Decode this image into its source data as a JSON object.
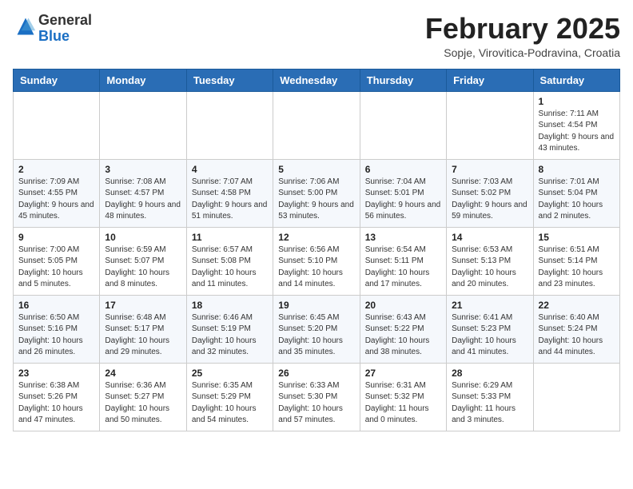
{
  "header": {
    "logo_general": "General",
    "logo_blue": "Blue",
    "month": "February 2025",
    "location": "Sopje, Virovitica-Podravina, Croatia"
  },
  "weekdays": [
    "Sunday",
    "Monday",
    "Tuesday",
    "Wednesday",
    "Thursday",
    "Friday",
    "Saturday"
  ],
  "weeks": [
    [
      {
        "day": "",
        "info": ""
      },
      {
        "day": "",
        "info": ""
      },
      {
        "day": "",
        "info": ""
      },
      {
        "day": "",
        "info": ""
      },
      {
        "day": "",
        "info": ""
      },
      {
        "day": "",
        "info": ""
      },
      {
        "day": "1",
        "info": "Sunrise: 7:11 AM\nSunset: 4:54 PM\nDaylight: 9 hours and 43 minutes."
      }
    ],
    [
      {
        "day": "2",
        "info": "Sunrise: 7:09 AM\nSunset: 4:55 PM\nDaylight: 9 hours and 45 minutes."
      },
      {
        "day": "3",
        "info": "Sunrise: 7:08 AM\nSunset: 4:57 PM\nDaylight: 9 hours and 48 minutes."
      },
      {
        "day": "4",
        "info": "Sunrise: 7:07 AM\nSunset: 4:58 PM\nDaylight: 9 hours and 51 minutes."
      },
      {
        "day": "5",
        "info": "Sunrise: 7:06 AM\nSunset: 5:00 PM\nDaylight: 9 hours and 53 minutes."
      },
      {
        "day": "6",
        "info": "Sunrise: 7:04 AM\nSunset: 5:01 PM\nDaylight: 9 hours and 56 minutes."
      },
      {
        "day": "7",
        "info": "Sunrise: 7:03 AM\nSunset: 5:02 PM\nDaylight: 9 hours and 59 minutes."
      },
      {
        "day": "8",
        "info": "Sunrise: 7:01 AM\nSunset: 5:04 PM\nDaylight: 10 hours and 2 minutes."
      }
    ],
    [
      {
        "day": "9",
        "info": "Sunrise: 7:00 AM\nSunset: 5:05 PM\nDaylight: 10 hours and 5 minutes."
      },
      {
        "day": "10",
        "info": "Sunrise: 6:59 AM\nSunset: 5:07 PM\nDaylight: 10 hours and 8 minutes."
      },
      {
        "day": "11",
        "info": "Sunrise: 6:57 AM\nSunset: 5:08 PM\nDaylight: 10 hours and 11 minutes."
      },
      {
        "day": "12",
        "info": "Sunrise: 6:56 AM\nSunset: 5:10 PM\nDaylight: 10 hours and 14 minutes."
      },
      {
        "day": "13",
        "info": "Sunrise: 6:54 AM\nSunset: 5:11 PM\nDaylight: 10 hours and 17 minutes."
      },
      {
        "day": "14",
        "info": "Sunrise: 6:53 AM\nSunset: 5:13 PM\nDaylight: 10 hours and 20 minutes."
      },
      {
        "day": "15",
        "info": "Sunrise: 6:51 AM\nSunset: 5:14 PM\nDaylight: 10 hours and 23 minutes."
      }
    ],
    [
      {
        "day": "16",
        "info": "Sunrise: 6:50 AM\nSunset: 5:16 PM\nDaylight: 10 hours and 26 minutes."
      },
      {
        "day": "17",
        "info": "Sunrise: 6:48 AM\nSunset: 5:17 PM\nDaylight: 10 hours and 29 minutes."
      },
      {
        "day": "18",
        "info": "Sunrise: 6:46 AM\nSunset: 5:19 PM\nDaylight: 10 hours and 32 minutes."
      },
      {
        "day": "19",
        "info": "Sunrise: 6:45 AM\nSunset: 5:20 PM\nDaylight: 10 hours and 35 minutes."
      },
      {
        "day": "20",
        "info": "Sunrise: 6:43 AM\nSunset: 5:22 PM\nDaylight: 10 hours and 38 minutes."
      },
      {
        "day": "21",
        "info": "Sunrise: 6:41 AM\nSunset: 5:23 PM\nDaylight: 10 hours and 41 minutes."
      },
      {
        "day": "22",
        "info": "Sunrise: 6:40 AM\nSunset: 5:24 PM\nDaylight: 10 hours and 44 minutes."
      }
    ],
    [
      {
        "day": "23",
        "info": "Sunrise: 6:38 AM\nSunset: 5:26 PM\nDaylight: 10 hours and 47 minutes."
      },
      {
        "day": "24",
        "info": "Sunrise: 6:36 AM\nSunset: 5:27 PM\nDaylight: 10 hours and 50 minutes."
      },
      {
        "day": "25",
        "info": "Sunrise: 6:35 AM\nSunset: 5:29 PM\nDaylight: 10 hours and 54 minutes."
      },
      {
        "day": "26",
        "info": "Sunrise: 6:33 AM\nSunset: 5:30 PM\nDaylight: 10 hours and 57 minutes."
      },
      {
        "day": "27",
        "info": "Sunrise: 6:31 AM\nSunset: 5:32 PM\nDaylight: 11 hours and 0 minutes."
      },
      {
        "day": "28",
        "info": "Sunrise: 6:29 AM\nSunset: 5:33 PM\nDaylight: 11 hours and 3 minutes."
      },
      {
        "day": "",
        "info": ""
      }
    ]
  ]
}
